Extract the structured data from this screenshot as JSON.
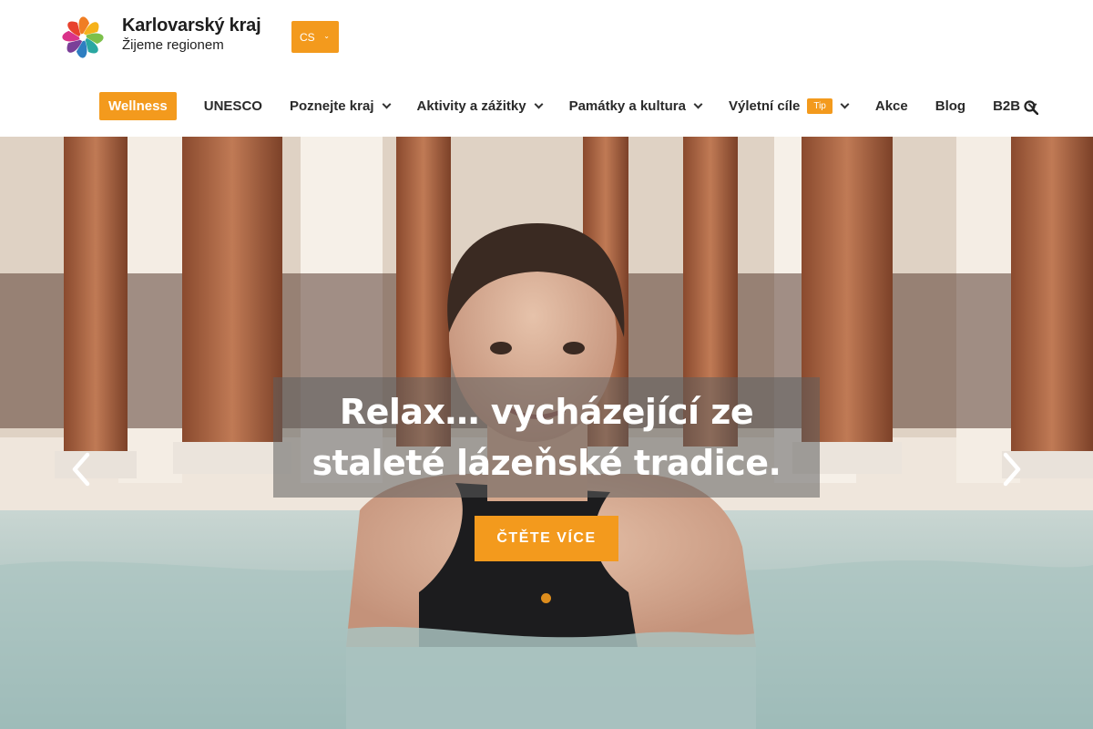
{
  "brand": {
    "title": "Karlovarský kraj",
    "subtitle": "Žijeme regionem",
    "accent_color": "#f39a1d"
  },
  "language": {
    "selected": "CS",
    "icon": "chevron-down-icon"
  },
  "nav": {
    "items": [
      {
        "label": "Wellness",
        "active": true,
        "dropdown": false
      },
      {
        "label": "UNESCO",
        "dropdown": false
      },
      {
        "label": "Poznejte kraj",
        "dropdown": true
      },
      {
        "label": "Aktivity a zážitky",
        "dropdown": true
      },
      {
        "label": "Památky a kultura",
        "dropdown": true
      },
      {
        "label": "Výletní cíle",
        "dropdown": true,
        "badge": "Tip"
      },
      {
        "label": "Akce",
        "dropdown": false
      },
      {
        "label": "Blog",
        "dropdown": false
      },
      {
        "label": "B2B",
        "dropdown": true
      }
    ],
    "search_icon": "search-icon"
  },
  "hero": {
    "headline": "Relax… vycházející ze staleté lázeňské tradice.",
    "cta_label": "ČTĚTE VÍCE",
    "prev_icon": "chevron-left-icon",
    "next_icon": "chevron-right-icon",
    "slides_count": 1,
    "active_slide": 1
  }
}
